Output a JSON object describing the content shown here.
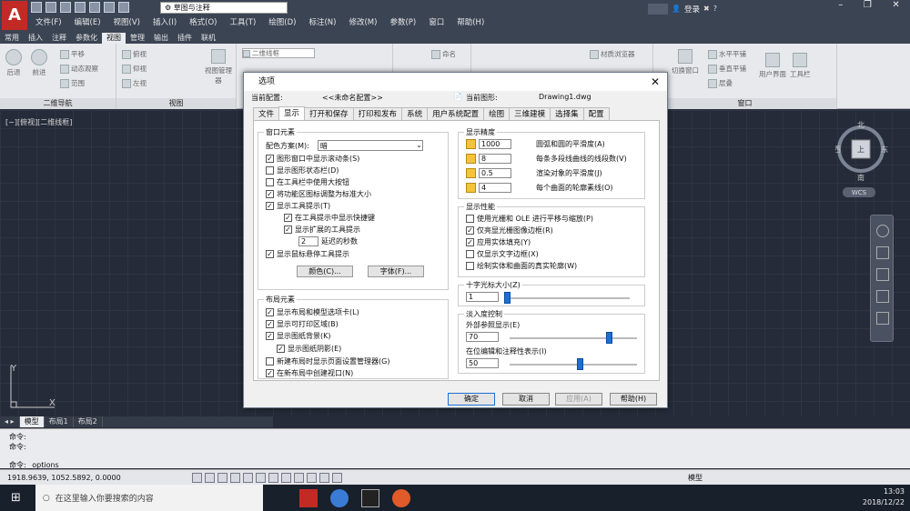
{
  "app": {
    "logo": "A",
    "workspace": "草图与注释",
    "login": "登录",
    "menus": [
      "文件(F)",
      "编辑(E)",
      "视图(V)",
      "插入(I)",
      "格式(O)",
      "工具(T)",
      "绘图(D)",
      "标注(N)",
      "修改(M)",
      "参数(P)",
      "窗口",
      "帮助(H)"
    ]
  },
  "ribbon": {
    "tabs": [
      "常用",
      "插入",
      "注释",
      "参数化",
      "视图",
      "管理",
      "输出",
      "插件",
      "联机"
    ],
    "active_tab": "视图",
    "groups": [
      {
        "name": "二维导航",
        "buttons": [
          "后退",
          "前进",
          "平移",
          "动态观察",
          "范围"
        ]
      },
      {
        "name": "视图",
        "buttons": [
          "俯视",
          "仰视",
          "左视",
          "视图管理器"
        ]
      },
      {
        "name": "",
        "buttons": [
          "二维线框"
        ]
      },
      {
        "name": "",
        "buttons": [
          "命名"
        ]
      },
      {
        "name": "",
        "buttons": [
          "材质浏览器"
        ]
      },
      {
        "name": "窗口",
        "buttons": [
          "切换窗口",
          "水平平铺",
          "垂直平铺",
          "层叠",
          "用户界面",
          "工具栏"
        ]
      }
    ]
  },
  "canvas": {
    "view_label": "[−][俯视][二维线框]",
    "compass": {
      "n": "北",
      "s": "南",
      "e": "东",
      "w": "西",
      "top": "上"
    },
    "wcs": "WCS",
    "ucs_x": "X",
    "ucs_y": "Y"
  },
  "layout_tabs": [
    "模型",
    "布局1",
    "布局2"
  ],
  "command": {
    "lines": [
      "命令:",
      "命令:"
    ],
    "prompt": "命令:  _options"
  },
  "status": {
    "coords": "1918.9639, 1052.5892, 0.0000",
    "model": "模型"
  },
  "taskbar": {
    "search": "在这里输入你要搜索的内容",
    "time": "13:03",
    "date": "2018/12/22"
  },
  "dialog": {
    "title": "选项",
    "current_profile_label": "当前配置:",
    "current_profile": "<<未命名配置>>",
    "current_drawing_label": "当前图形:",
    "current_drawing": "Drawing1.dwg",
    "tabs": [
      "文件",
      "显示",
      "打开和保存",
      "打印和发布",
      "系统",
      "用户系统配置",
      "绘图",
      "三维建模",
      "选择集",
      "配置"
    ],
    "active_tab": "显示",
    "window_elements": {
      "title": "窗口元素",
      "scheme_label": "配色方案(M):",
      "scheme": "暗",
      "checks": [
        {
          "label": "图形窗口中显示滚动条(S)",
          "on": true
        },
        {
          "label": "显示图形状态栏(D)",
          "on": false
        },
        {
          "label": "在工具栏中使用大按钮",
          "on": false
        },
        {
          "label": "将功能区图标调整为标准大小",
          "on": true
        },
        {
          "label": "显示工具提示(T)",
          "on": true
        }
      ],
      "sub_checks": [
        {
          "label": "在工具提示中显示快捷键",
          "on": true
        },
        {
          "label": "显示扩展的工具提示",
          "on": true
        }
      ],
      "delay_value": "2",
      "delay_label": "延迟的秒数",
      "rollover": {
        "label": "显示鼠标悬停工具提示",
        "on": true
      },
      "colors_btn": "颜色(C)...",
      "fonts_btn": "字体(F)..."
    },
    "layout_elements": {
      "title": "布局元素",
      "checks": [
        {
          "label": "显示布局和模型选项卡(L)",
          "on": true
        },
        {
          "label": "显示可打印区域(B)",
          "on": true
        },
        {
          "label": "显示图纸背景(K)",
          "on": true
        }
      ],
      "shadow": {
        "label": "显示图纸阴影(E)",
        "on": true
      },
      "checks2": [
        {
          "label": "新建布局时显示页面设置管理器(G)",
          "on": false
        },
        {
          "label": "在新布局中创建视口(N)",
          "on": true
        }
      ]
    },
    "resolution": {
      "title": "显示精度",
      "items": [
        {
          "value": "1000",
          "label": "圆弧和圆的平滑度(A)"
        },
        {
          "value": "8",
          "label": "每条多段线曲线的线段数(V)"
        },
        {
          "value": "0.5",
          "label": "渲染对象的平滑度(J)"
        },
        {
          "value": "4",
          "label": "每个曲面的轮廓素线(O)"
        }
      ]
    },
    "performance": {
      "title": "显示性能",
      "items": [
        {
          "label": "使用光栅和 OLE 进行平移与缩放(P)",
          "on": false
        },
        {
          "label": "仅亮显光栅图像边框(R)",
          "on": true
        },
        {
          "label": "应用实体填充(Y)",
          "on": true
        },
        {
          "label": "仅显示文字边框(X)",
          "on": false
        },
        {
          "label": "绘制实体和曲面的真实轮廓(W)",
          "on": false
        }
      ]
    },
    "crosshair": {
      "title": "十字光标大小(Z)",
      "value": "1",
      "fraction": 0.01
    },
    "fade": {
      "title": "淡入度控制",
      "xref_label": "外部参照显示(E)",
      "xref_value": "70",
      "xref_fraction": 0.78,
      "inplace_label": "在位编辑和注释性表示(I)",
      "inplace_value": "50",
      "inplace_fraction": 0.55
    },
    "buttons": {
      "ok": "确定",
      "cancel": "取消",
      "apply": "应用(A)",
      "help": "帮助(H)"
    }
  }
}
